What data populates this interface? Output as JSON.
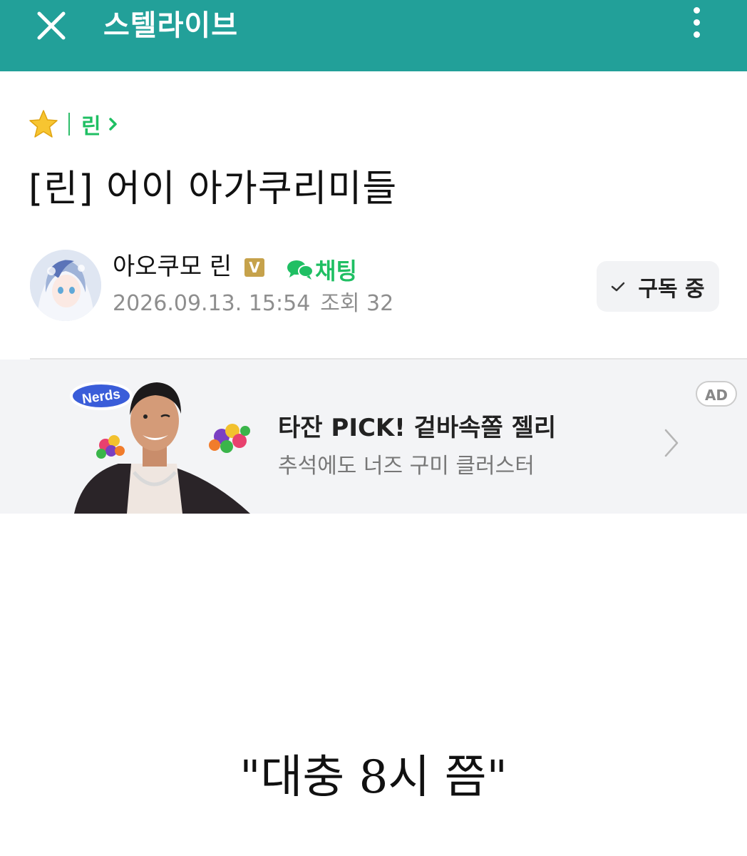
{
  "appbar": {
    "title": "스텔라이브",
    "background": "#22a099",
    "close_icon": "close-icon",
    "more_icon": "more-vertical-icon"
  },
  "breadcrumb": {
    "icon": "star-icon",
    "board": "린",
    "chevron": "chevron-right-icon",
    "accent": "#1fbf63"
  },
  "post": {
    "title": "[린] 어이 아가쿠리미들",
    "body": "\"대충 8시 쯤\""
  },
  "author": {
    "name": "아오쿠모 린",
    "badge": "V",
    "chat_label": "채팅",
    "date": "2026.09.13. 15:54",
    "views": "조회 32",
    "subscribe_label": "구독 중"
  },
  "ad": {
    "brand": "Nerds",
    "title": "타잔 PICK! 겉바속쫄 젤리",
    "subtitle": "추석에도 너즈 구미 클러스터",
    "badge": "AD"
  }
}
